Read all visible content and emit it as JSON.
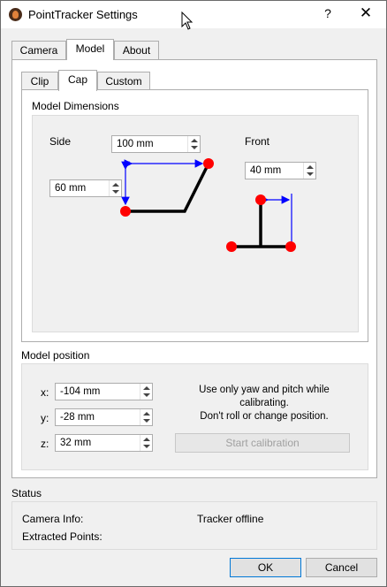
{
  "window": {
    "title": "PointTracker Settings",
    "help_label": "?",
    "close_label": "✕"
  },
  "tabs": [
    "Camera",
    "Model",
    "About"
  ],
  "subtabs": [
    "Clip",
    "Cap",
    "Custom"
  ],
  "model_dimensions": {
    "title": "Model Dimensions",
    "side_label": "Side",
    "front_label": "Front",
    "side_length": "100 mm",
    "side_height": "60 mm",
    "front_width": "40 mm",
    "line_color": "#000000",
    "point_color": "#ff0000",
    "arrow_color": "#0000ff"
  },
  "model_position": {
    "title": "Model position",
    "x_label": "x:",
    "x_value": "-104 mm",
    "y_label": "y:",
    "y_value": "-28 mm",
    "z_label": "z:",
    "z_value": "32 mm",
    "hint_line1": "Use only yaw and pitch while calibrating.",
    "hint_line2": "Don't roll or change position.",
    "calibrate_label": "Start calibration"
  },
  "status": {
    "title": "Status",
    "camera_info_label": "Camera Info:",
    "tracker_state": "Tracker offline",
    "extracted_points_label": "Extracted Points:"
  },
  "footer": {
    "ok_label": "OK",
    "cancel_label": "Cancel"
  }
}
